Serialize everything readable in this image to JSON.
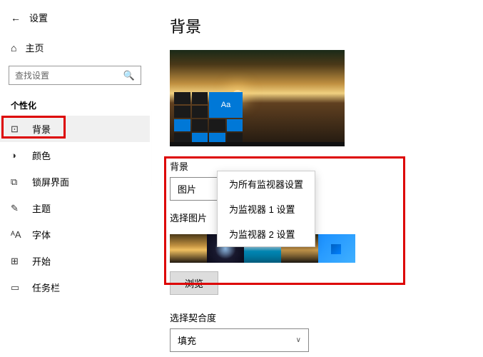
{
  "header": {
    "window_title": "设置",
    "home_label": "主页",
    "search_placeholder": "查找设置"
  },
  "sidebar": {
    "section": "个性化",
    "items": [
      {
        "icon": "background-icon",
        "label": "背景",
        "glyph": "⊡"
      },
      {
        "icon": "colors-icon",
        "label": "颜色",
        "glyph": "◑"
      },
      {
        "icon": "lockscreen-icon",
        "label": "锁屏界面",
        "glyph": "⧉"
      },
      {
        "icon": "themes-icon",
        "label": "主题",
        "glyph": "✎"
      },
      {
        "icon": "fonts-icon",
        "label": "字体",
        "glyph": "ᴬA"
      },
      {
        "icon": "start-icon",
        "label": "开始",
        "glyph": "⊞"
      },
      {
        "icon": "taskbar-icon",
        "label": "任务栏",
        "glyph": "▭"
      }
    ]
  },
  "main": {
    "title": "背景",
    "preview_tile_label": "Aa",
    "bg_section": {
      "label": "背景",
      "dropdown_value": "图片",
      "context_menu": [
        "为所有监视器设置",
        "为监视器 1 设置",
        "为监视器 2 设置"
      ],
      "choose_label": "选择图片",
      "browse_label": "浏览"
    },
    "fit_section": {
      "label": "选择契合度",
      "dropdown_value": "填充"
    }
  }
}
